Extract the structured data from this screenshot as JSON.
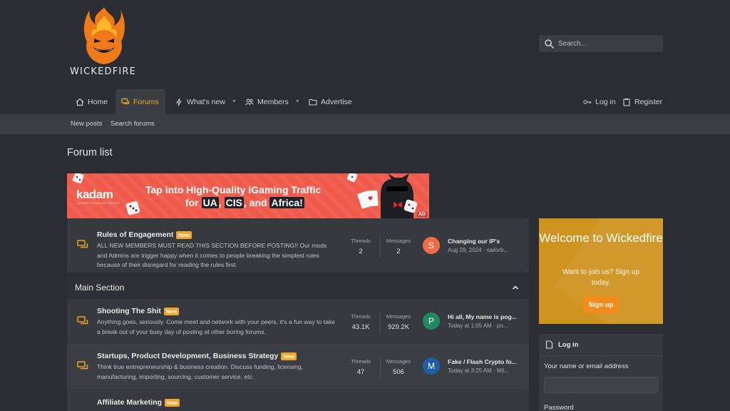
{
  "brand": {
    "name": "WICKEDFIRE"
  },
  "search": {
    "placeholder": "Search..."
  },
  "nav": {
    "items": [
      {
        "label": "Home"
      },
      {
        "label": "Forums"
      },
      {
        "label": "What's new"
      },
      {
        "label": "Members"
      },
      {
        "label": "Advertise"
      }
    ],
    "login": "Log in",
    "register": "Register"
  },
  "subnav": {
    "new_posts": "New posts",
    "search_forums": "Search forums"
  },
  "page": {
    "title": "Forum list"
  },
  "ad": {
    "brand": "kadam",
    "brand_sub": "ADVERTISING NETWORK",
    "line1": "Tap into High-Quality iGaming Traffic",
    "line2_prefix": "for",
    "geo1": "UA",
    "geo2": "CIS",
    "line2_mid": ", and",
    "geo3": "Africa!",
    "badge": "AD"
  },
  "rules_node": {
    "title": "Rules of Engagement",
    "badge": "New",
    "desc": "ALL NEW MEMBERS MUST READ THIS SECTION BEFORE POSTING!! Our mods and Admins are trigger happy when it comes to people breaking the simplest rules because of their disregard for reading the rules first.",
    "threads_label": "Threads",
    "threads": "2",
    "messages_label": "Messages",
    "messages": "2",
    "avatar_letter": "S",
    "avatar_color": "#f06b47",
    "latest_title": "Changing our IP's",
    "latest_meta": "Aug 29, 2024 · sailorb..."
  },
  "main_section": {
    "title": "Main Section",
    "nodes": [
      {
        "title": "Shooting The Shit",
        "badge": "New",
        "desc": "Anything goes, seriously. Come meet and network with your peers, it's a fun way to take a break out of your busy day of posting at other boring forums.",
        "threads_label": "Threads",
        "threads": "43.1K",
        "messages_label": "Messages",
        "messages": "929.2K",
        "avatar_letter": "P",
        "avatar_color": "#1e8a64",
        "latest_title": "Hi all, My name is pog...",
        "latest_meta": "Today at 1:05 AM · po..."
      },
      {
        "title": "Startups, Product Development, Business Strategy",
        "badge": "New",
        "desc": "Think true entrepreneurship & business creation. Discuss funding, licensing, manufacturing, importing, sourcing, customer service, etc.",
        "threads_label": "Threads",
        "threads": "47",
        "messages_label": "Messages",
        "messages": "506",
        "avatar_letter": "M",
        "avatar_color": "#1f5fa8",
        "latest_title": "Fake / Flash Crypto fo...",
        "latest_meta": "Today at 3:25 AM · Mil..."
      },
      {
        "title": "Affiliate Marketing",
        "badge": "New"
      }
    ]
  },
  "welcome": {
    "title": "Welcome to Wickedfire",
    "text": "Want to join us? Sign up today.",
    "button": "Sign up"
  },
  "login_box": {
    "title": "Log in",
    "username_label": "Your name or email address",
    "password_label": "Password"
  },
  "colors": {
    "accent": "#f3a42b",
    "welcome_bg": "#cf931f",
    "ad_bg": "#ef5a4a"
  }
}
